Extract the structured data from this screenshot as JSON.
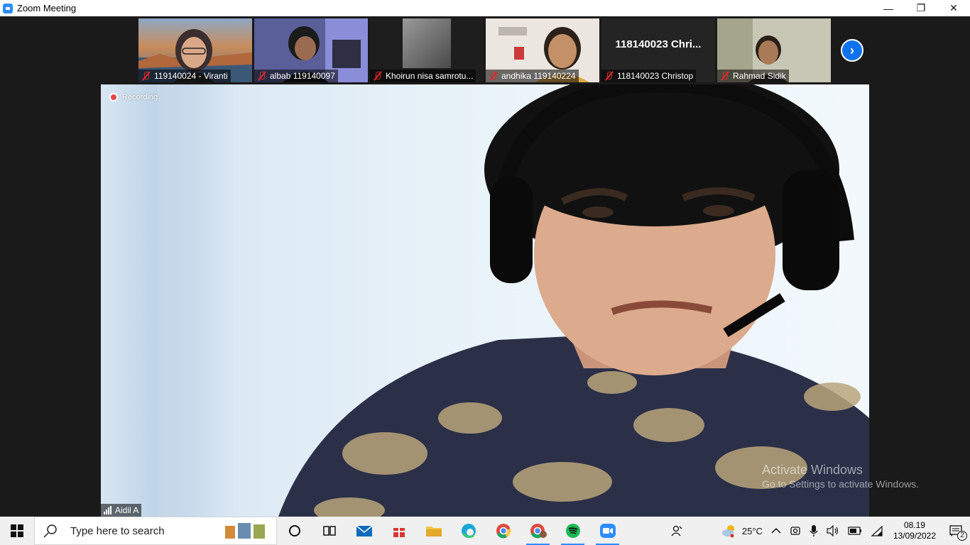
{
  "window": {
    "title": "Zoom Meeting",
    "minimize": "—",
    "restore": "❐",
    "close": "✕"
  },
  "participants": [
    {
      "name": "119140024 - Viranti",
      "muted": true
    },
    {
      "name": "albab 119140097",
      "muted": true
    },
    {
      "name": "Khoirun nisa samrotu...",
      "muted": true
    },
    {
      "name": "andhika 119140224",
      "muted": true
    },
    {
      "name": "118140023 Christop",
      "muted": true,
      "tile_title": "118140023 Chri..."
    },
    {
      "name": "Rahmad Sidik",
      "muted": true
    }
  ],
  "gallery_next": "›",
  "main": {
    "recording_label": "Recording",
    "speaker_name": "Aidil A"
  },
  "watermark": {
    "line1": "Activate Windows",
    "line2": "Go to Settings to activate Windows."
  },
  "taskbar": {
    "search_placeholder": "Type here to search",
    "temperature": "25°C",
    "time": "08.19",
    "date": "13/09/2022",
    "notification_count": "2"
  },
  "colors": {
    "zoom_blue": "#2d8cff",
    "muted_red": "#e02828",
    "recording_red": "#e54545"
  }
}
